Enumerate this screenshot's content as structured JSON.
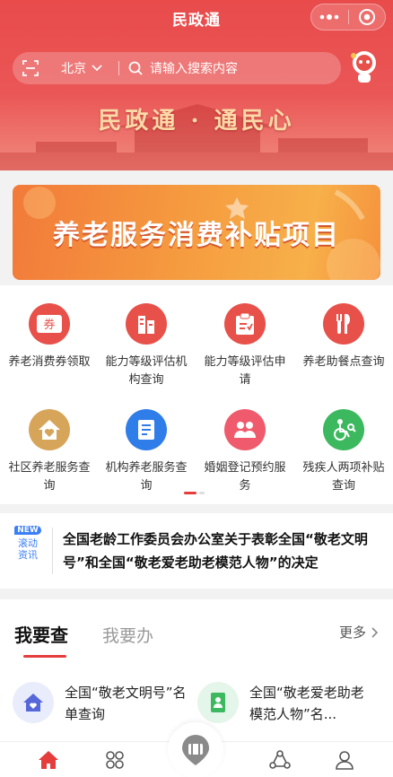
{
  "app": {
    "title": "民政通"
  },
  "search": {
    "city": "北京",
    "placeholder": "请输入搜索内容"
  },
  "hero": {
    "slogan": "民政通 · 通民心"
  },
  "banner": {
    "title": "养老服务消费补贴项目"
  },
  "grid": {
    "items": [
      {
        "label": "养老消费券领取",
        "icon": "coupon-icon",
        "color": "#e8504a"
      },
      {
        "label": "能力等级评估机构查询",
        "icon": "building-icon",
        "color": "#e8504a"
      },
      {
        "label": "能力等级评估申请",
        "icon": "clipboard-icon",
        "color": "#e8504a"
      },
      {
        "label": "养老助餐点查询",
        "icon": "utensils-icon",
        "color": "#e8504a"
      },
      {
        "label": "社区养老服务查询",
        "icon": "home-heart-icon",
        "color": "#d7a55a"
      },
      {
        "label": "机构养老服务查询",
        "icon": "document-icon",
        "color": "#2f7de8"
      },
      {
        "label": "婚姻登记预约服务",
        "icon": "couple-icon",
        "color": "#ef5b6c"
      },
      {
        "label": "残疾人两项补贴查询",
        "icon": "wheelchair-icon",
        "color": "#3cb85e"
      }
    ],
    "coupon_char": "券"
  },
  "news": {
    "badge_new": "NEW",
    "badge_text": "滚动资讯",
    "headline": "全国老龄工作委员会办公室关于表彰全国“敬老文明号”和全国“敬老爱老助老模范人物”的决定"
  },
  "tabs": {
    "active": "我要查",
    "inactive": "我要办",
    "more": "更多",
    "services": [
      {
        "label": "全国“敬老文明号”名单查询",
        "icon": "house-icon",
        "bg": "#e9ecfb",
        "color": "#5567d9"
      },
      {
        "label": "全国“敬老爱老助老模范人物”名...",
        "icon": "person-doc-icon",
        "bg": "#e4f5ea",
        "color": "#3cb85e"
      }
    ]
  },
  "colors": {
    "brand": "#e94b4b",
    "accent_red": "#e53c3c"
  }
}
